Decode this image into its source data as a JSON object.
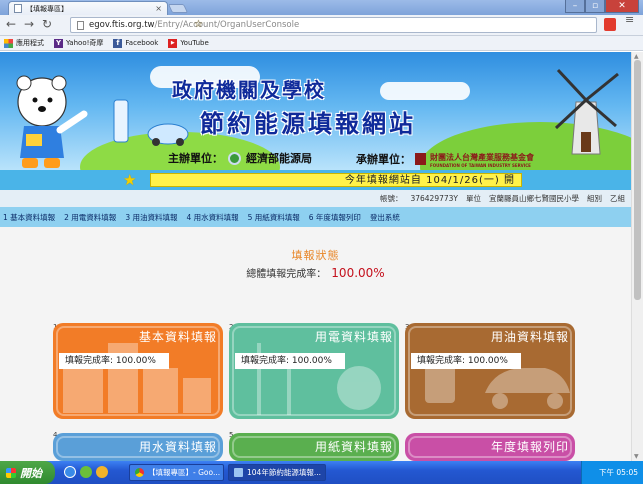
{
  "browser": {
    "tab_title": "【填報專區】",
    "tab_close": "×",
    "url_host": "egov.ftis.org.tw",
    "url_path": "/Entry/Account/OrganUserConsole",
    "bookmarks": [
      {
        "label": "應用程式",
        "icon": "apps-icon"
      },
      {
        "label": "Yahoo!奇摩",
        "icon": "yahoo-icon",
        "glyph": "Y"
      },
      {
        "label": "Facebook",
        "icon": "facebook-icon",
        "glyph": "f"
      },
      {
        "label": "YouTube",
        "icon": "youtube-icon",
        "glyph": "▶"
      }
    ]
  },
  "banner": {
    "title_line1": "政府機關及學校",
    "title_line2": "節約能源填報網站",
    "sponsor_label": "主辦單位：",
    "sponsor_name": "經濟部能源局",
    "organizer_label": "承辦單位：",
    "organizer_name": "財團法人台灣產業服務基金會",
    "organizer_sub": "FOUNDATION OF TAIWAN INDUSTRY SERVICE"
  },
  "notice": {
    "text": "今年填報網站自 104/1/26(一) 開"
  },
  "account_info": {
    "account_label": "帳號：",
    "account_value": "376429773Y",
    "unit_label": "單位",
    "unit_value": "宜蘭縣員山鄉七賢國民小學",
    "group_label": "組別",
    "group_value": "乙組"
  },
  "nav": [
    "1 基本資料填報",
    "2 用電資料填報",
    "3 用油資料填報",
    "4 用水資料填報",
    "5 用紙資料填報",
    "6 年度填報列印",
    "登出系統"
  ],
  "status": {
    "title": "填報狀態",
    "overall_label": "總體填報完成率：",
    "overall_value": "100.00%"
  },
  "cards": [
    {
      "num": "1",
      "title": "基本資料填報",
      "rate": "填報完成率: 100.00%",
      "color": "#f27c27"
    },
    {
      "num": "2",
      "title": "用電資料填報",
      "rate": "填報完成率: 100.00%",
      "color": "#5fbf9e"
    },
    {
      "num": "3",
      "title": "用油資料填報",
      "rate": "填報完成率: 100.00%",
      "color": "#a86a32"
    },
    {
      "num": "4",
      "title": "用水資料填報",
      "rate": "",
      "color": "#5a9fd8"
    },
    {
      "num": "5",
      "title": "用紙資料填報",
      "rate": "",
      "color": "#5aaf4f"
    },
    {
      "num": "",
      "title": "年度填報列印",
      "rate": "",
      "color": "#c94fa6"
    }
  ],
  "taskbar": {
    "start_label": "開始",
    "tasks": [
      "【填報專區】- Goo...",
      "104年節約能源填報..."
    ],
    "clock": "下午 05:05"
  }
}
